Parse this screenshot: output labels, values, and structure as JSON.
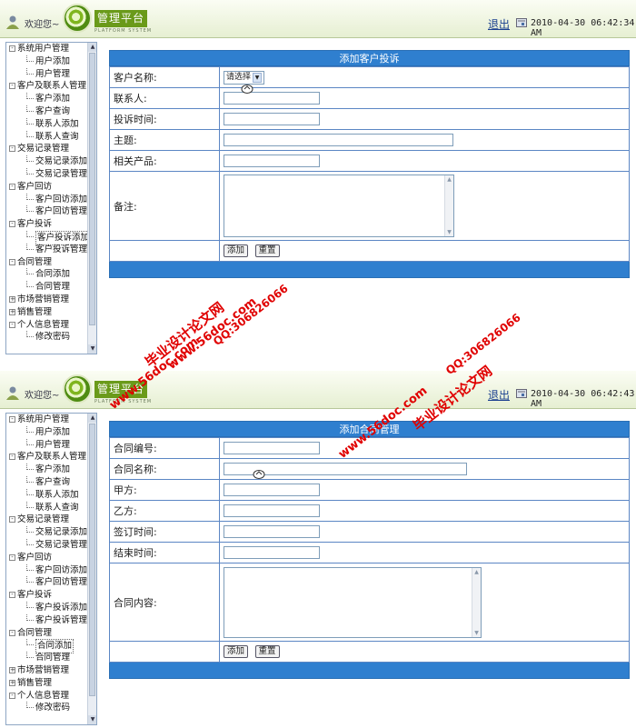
{
  "header": {
    "welcome": "欢迎您~",
    "logo_title": "管理平台",
    "logo_subtitle": "PLATFORM SYSTEM",
    "exit": "退出",
    "datetime_1": "2010-04-30 06:42:34 AM",
    "datetime_2": "2010-04-30 06:42:43 AM"
  },
  "tree": [
    {
      "type": "cat",
      "label": "系统用户管理",
      "exp": "-"
    },
    {
      "type": "child",
      "label": "用户添加"
    },
    {
      "type": "child",
      "label": "用户管理"
    },
    {
      "type": "cat",
      "label": "客户及联系人管理",
      "exp": "-"
    },
    {
      "type": "child",
      "label": "客户添加"
    },
    {
      "type": "child",
      "label": "客户查询"
    },
    {
      "type": "child",
      "label": "联系人添加"
    },
    {
      "type": "child",
      "label": "联系人查询"
    },
    {
      "type": "cat",
      "label": "交易记录管理",
      "exp": "-"
    },
    {
      "type": "child",
      "label": "交易记录添加"
    },
    {
      "type": "child",
      "label": "交易记录管理"
    },
    {
      "type": "cat",
      "label": "客户回访",
      "exp": "-"
    },
    {
      "type": "child",
      "label": "客户回访添加"
    },
    {
      "type": "child",
      "label": "客户回访管理"
    },
    {
      "type": "cat",
      "label": "客户投诉",
      "exp": "-"
    },
    {
      "type": "child",
      "label": "客户投诉添加"
    },
    {
      "type": "child",
      "label": "客户投诉管理"
    },
    {
      "type": "cat",
      "label": "合同管理",
      "exp": "-"
    },
    {
      "type": "child",
      "label": "合同添加"
    },
    {
      "type": "child",
      "label": "合同管理"
    },
    {
      "type": "cat",
      "label": "市场营销管理",
      "exp": "+"
    },
    {
      "type": "cat",
      "label": "销售管理",
      "exp": "+"
    },
    {
      "type": "cat",
      "label": "个人信息管理",
      "exp": "-"
    },
    {
      "type": "child",
      "label": "修改密码"
    }
  ],
  "complaint_form": {
    "title": "添加客户投诉",
    "customer_name_label": "客户名称:",
    "customer_select_value": "请选择",
    "contact_label": "联系人:",
    "complaint_time_label": "投诉时间:",
    "subject_label": "主题:",
    "product_label": "相关产品:",
    "remarks_label": "备注:",
    "add_button": "添加",
    "reset_button": "重置"
  },
  "contract_form": {
    "title": "添加合同管理",
    "number_label": "合同编号:",
    "name_label": "合同名称:",
    "party_a_label": "甲方:",
    "party_b_label": "乙方:",
    "sign_time_label": "签订时间:",
    "end_time_label": "结束时间:",
    "content_label": "合同内容:",
    "add_button": "添加",
    "reset_button": "重置"
  },
  "watermarks": {
    "site_name": "毕业设计论文网",
    "site_url": "www.56doc.com",
    "qq": "QQ:306826066"
  },
  "colors": {
    "form_header": "#2f7fcf",
    "table_border": "#5b86c4",
    "logo_green": "#6a9a1a",
    "watermark": "#e00000"
  }
}
